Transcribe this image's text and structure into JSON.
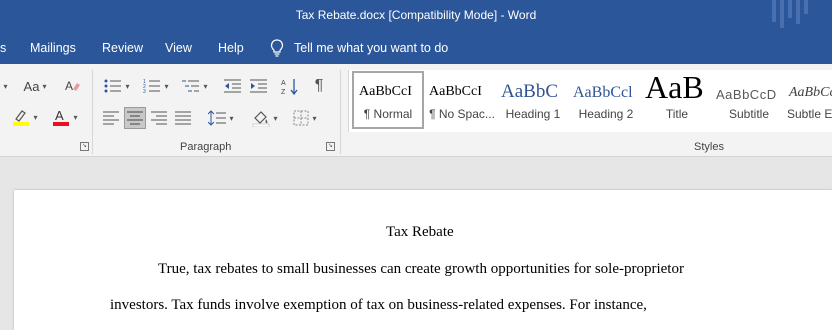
{
  "window": {
    "title": "Tax Rebate.docx [Compatibility Mode]  -  Word"
  },
  "tabs": {
    "partial_left": "s",
    "mailings": "Mailings",
    "review": "Review",
    "view": "View",
    "help": "Help"
  },
  "tell_me": {
    "placeholder": "Tell me what you want to do",
    "icon": "lightbulb-icon"
  },
  "ribbon": {
    "font": {
      "change_case_label": "Aa",
      "icons": [
        "clear-formatting-icon",
        "text-highlight-icon",
        "font-color-icon"
      ],
      "highlight_color": "#ffff00",
      "font_color": "#e81123"
    },
    "paragraph": {
      "label": "Paragraph",
      "icons": [
        "bullets-icon",
        "numbering-icon",
        "multilevel-list-icon",
        "decrease-indent-icon",
        "increase-indent-icon",
        "sort-icon",
        "show-formatting-marks-icon",
        "align-left-icon",
        "align-center-icon",
        "align-right-icon",
        "justify-icon",
        "line-spacing-icon",
        "shading-icon",
        "borders-icon"
      ]
    },
    "styles": {
      "label": "Styles",
      "items": [
        {
          "preview": "AaBbCcI",
          "name": "¶ Normal",
          "selected": true
        },
        {
          "preview": "AaBbCcI",
          "name": "¶ No Spac..."
        },
        {
          "preview": "AaBbC",
          "name": "Heading 1",
          "color": "#2f5496"
        },
        {
          "preview": "AaBbCcl",
          "name": "Heading 2",
          "color": "#2f5496"
        },
        {
          "preview": "AaB",
          "name": "Title"
        },
        {
          "preview": "AaBbCcD",
          "name": "Subtitle",
          "color": "#595959"
        },
        {
          "preview": "AaBbCc",
          "name": "Subtle Em",
          "italic": true
        }
      ]
    }
  },
  "document": {
    "title": "Tax Rebate",
    "lines": [
      "True, tax rebates to small businesses can create growth opportunities for sole-proprietor",
      "investors. Tax funds involve exemption of tax on business-related expenses. For instance,"
    ]
  },
  "colors": {
    "title_bar": "#2b579a",
    "ribbon": "#f3f3f3",
    "workspace": "#e6e6e6"
  }
}
